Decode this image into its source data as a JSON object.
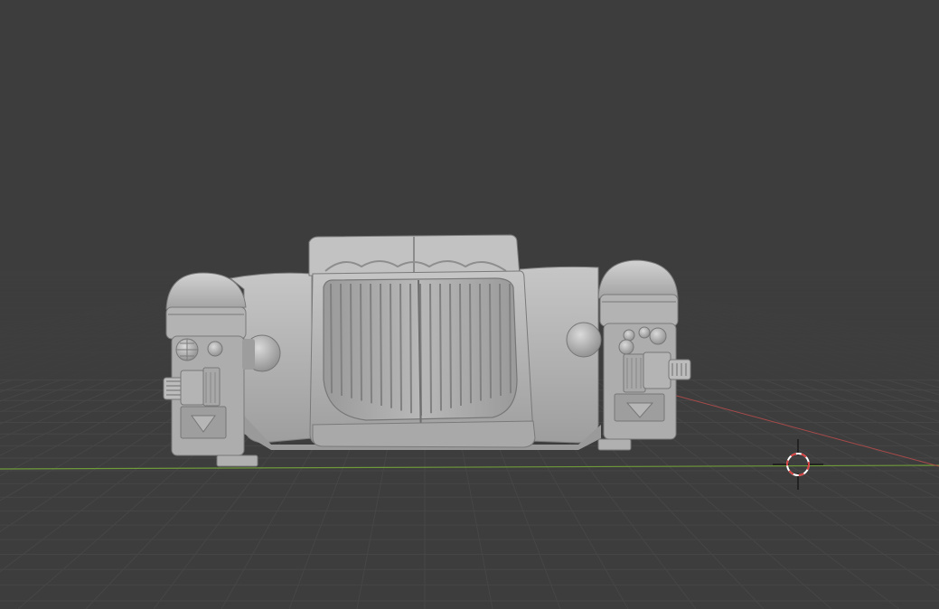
{
  "viewport": {
    "background_color": "#3d3d3d",
    "grid_color": "#464646",
    "x_axis_color": "#a84a4a",
    "y_axis_color": "#6f9a3a",
    "model_color": "#b9b9b9",
    "model_shadow_color": "#8a8a8a",
    "cursor_color_primary": "#d94040",
    "cursor_color_secondary": "#ffffff"
  },
  "model": {
    "description_icon": "3d-mesh-vehicle-front"
  },
  "cursor": {
    "icon": "3d-cursor-icon"
  }
}
